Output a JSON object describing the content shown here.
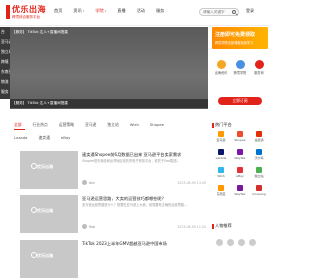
{
  "header": {
    "logo_title": "优乐出海",
    "logo_sub": "跨境综合服务平台",
    "nav": [
      {
        "label": "首页",
        "active": false,
        "has_arrow": false
      },
      {
        "label": "资讯",
        "active": false,
        "has_arrow": true
      },
      {
        "label": "学院",
        "active": true,
        "has_arrow": true
      },
      {
        "label": "直播",
        "active": false,
        "has_arrow": false
      },
      {
        "label": "活动",
        "active": false,
        "has_arrow": false
      },
      {
        "label": "服务",
        "active": false,
        "has_arrow": false
      }
    ],
    "search_placeholder": "请输入关键字",
    "login_label": "登录"
  },
  "side_menu": [
    "台",
    "亚马逊",
    "独立站",
    "跨境",
    "东南亚",
    "物流",
    "服务"
  ],
  "banner": {
    "caption": "【服务】 TikTok 达人+直播间搭建",
    "ticker": "【服务】 TikTok 达人+直播间搭建"
  },
  "promo": {
    "title": "注册即可免费领取",
    "sub": "跨境学院全部课程免费学习"
  },
  "quick_links": [
    {
      "label": "出海资讯",
      "color": "#f5a623"
    },
    {
      "label": "跨境学院",
      "color": "#4a90e2"
    },
    {
      "label": "服务商",
      "color": "#e2231a"
    }
  ],
  "subscribe_label": "立即订阅",
  "tabs_row1": [
    {
      "label": "全部",
      "active": true
    },
    {
      "label": "行业热点",
      "active": false
    },
    {
      "label": "运营策略",
      "active": false
    },
    {
      "label": "亚马逊",
      "active": false
    },
    {
      "label": "独立站",
      "active": false
    },
    {
      "label": "Wish",
      "active": false
    },
    {
      "label": "Shopee",
      "active": false
    }
  ],
  "tabs_row2": [
    {
      "label": "Lazada",
      "active": false
    },
    {
      "label": "速卖通",
      "active": false
    },
    {
      "label": "eBay",
      "active": false
    }
  ],
  "articles": [
    {
      "title": "速卖通Shopee前6月数据已出来 亚马逊平台卖家需求",
      "desc": "Shopee是东南亚和台湾地区领先的电子商务平台，依托于Sea集团...",
      "author": "Ann",
      "time": "2023-08-09 13:45",
      "thumb_label": "优乐出海"
    },
    {
      "title": "亚马逊运营思路，大卖的运营技巧都哪些呢？",
      "desc": "亚马逊运营思路是什么？想要在亚马逊上大卖，就需要有正确的运营思路...",
      "author": "Rob",
      "time": "2023-08-09 11:20",
      "thumb_label": "优乐出海"
    },
    {
      "title": "TikTok 2023上半年GMV超越亚马逊中国市场",
      "desc": "",
      "author": "",
      "time": "",
      "thumb_label": "优乐出海"
    }
  ],
  "platform_panel": {
    "title": "热门平台",
    "items": [
      {
        "label": "亚马逊",
        "color": "#f90"
      },
      {
        "label": "Shopee",
        "color": "#ee4d2d"
      },
      {
        "label": "速卖通",
        "color": "#e62e04"
      },
      {
        "label": "Lazada",
        "color": "#0f146d"
      },
      {
        "label": "Wayfair",
        "color": "#7b189f"
      },
      {
        "label": "沃尔玛",
        "color": "#0071ce"
      },
      {
        "label": "Wish",
        "color": "#2fb7ec"
      },
      {
        "label": "eBay",
        "color": "#e53238"
      },
      {
        "label": "独立站",
        "color": "#4caf50"
      },
      {
        "label": "东南亚",
        "color": "#ff9800"
      },
      {
        "label": "Wayfair",
        "color": "#7b189f"
      },
      {
        "label": "Coupang",
        "color": "#d32f2f"
      }
    ]
  },
  "people_panel": {
    "title": "人物推荐"
  }
}
